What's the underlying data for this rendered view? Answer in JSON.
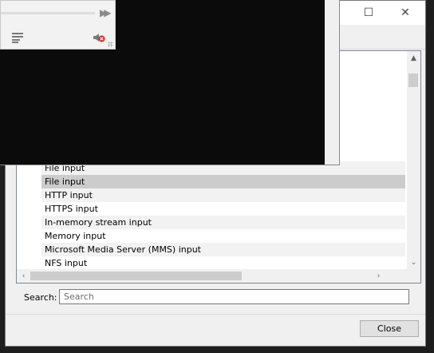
{
  "dialog": {
    "window_buttons": {
      "minimize": "—",
      "maximize": "☐",
      "close": "✕"
    },
    "list_items": [
      {
        "label": "File input",
        "state": "alt"
      },
      {
        "label": "File input",
        "state": "selected"
      },
      {
        "label": "HTTP input",
        "state": "alt"
      },
      {
        "label": "HTTPS input",
        "state": "normal"
      },
      {
        "label": "In-memory stream input",
        "state": "alt"
      },
      {
        "label": "Memory input",
        "state": "normal"
      },
      {
        "label": "Microsoft Media Server (MMS) input",
        "state": "alt"
      },
      {
        "label": "NFS input",
        "state": "normal"
      }
    ],
    "scroll_arrows": {
      "up": "▲",
      "down": "⌄",
      "left": "‹",
      "right": "›"
    },
    "search": {
      "label": "Search:",
      "placeholder": "Search",
      "value": ""
    },
    "close_button": "Close"
  },
  "player": {
    "icons": {
      "forward": "forward-icon",
      "playlist": "playlist-icon",
      "mute": "mute-icon"
    },
    "forward_glyph": "▶▶"
  }
}
